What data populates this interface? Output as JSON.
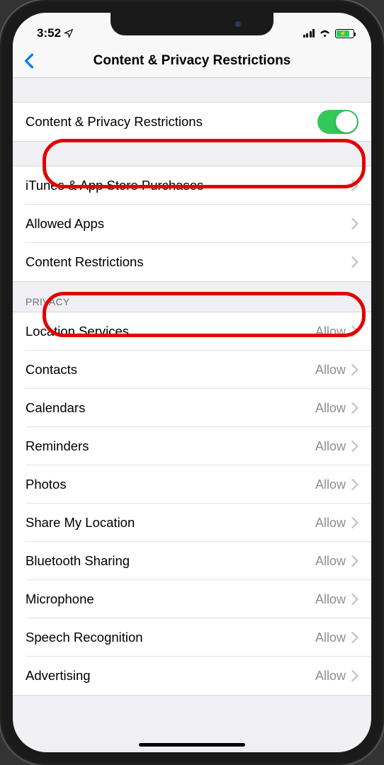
{
  "status": {
    "time": "3:52",
    "location_arrow": "➤"
  },
  "nav": {
    "title": "Content & Privacy Restrictions"
  },
  "toggle_row": {
    "label": "Content & Privacy Restrictions",
    "on": true
  },
  "main_items": [
    {
      "label": "iTunes & App Store Purchases"
    },
    {
      "label": "Allowed Apps"
    },
    {
      "label": "Content Restrictions"
    }
  ],
  "privacy_header": "Privacy",
  "privacy_items": [
    {
      "label": "Location Services",
      "value": "Allow"
    },
    {
      "label": "Contacts",
      "value": "Allow"
    },
    {
      "label": "Calendars",
      "value": "Allow"
    },
    {
      "label": "Reminders",
      "value": "Allow"
    },
    {
      "label": "Photos",
      "value": "Allow"
    },
    {
      "label": "Share My Location",
      "value": "Allow"
    },
    {
      "label": "Bluetooth Sharing",
      "value": "Allow"
    },
    {
      "label": "Microphone",
      "value": "Allow"
    },
    {
      "label": "Speech Recognition",
      "value": "Allow"
    },
    {
      "label": "Advertising",
      "value": "Allow"
    }
  ]
}
